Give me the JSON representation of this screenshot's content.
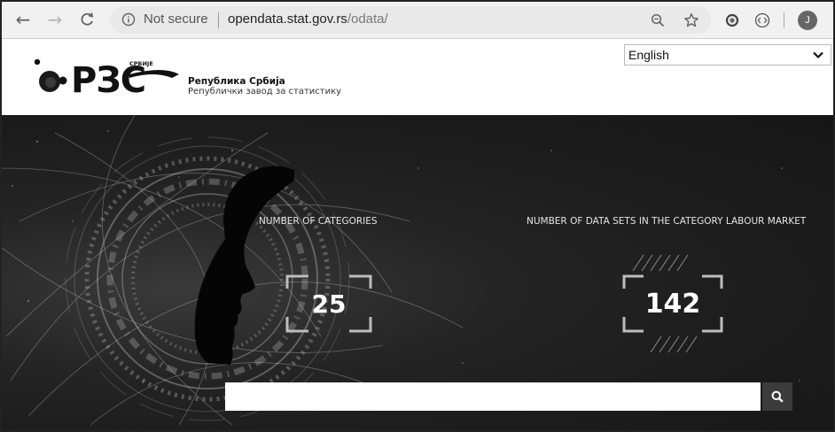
{
  "browser": {
    "security_label": "Not secure",
    "url_host": "opendata.stat.gov.rs",
    "url_path": "/odata/",
    "profile_initial": "J"
  },
  "header": {
    "logo_text": "РЗС",
    "logo_small": "СРБИЈЕ",
    "org_name": "Република Србија",
    "org_subtitle": "Републички завод за статистику",
    "language_selected": "English"
  },
  "stats": [
    {
      "label": "NUMBER OF CATEGORIES",
      "value": "25"
    },
    {
      "label": "NUMBER OF DATA SETS IN THE CATEGORY LABOUR MARKET",
      "value": "142"
    }
  ],
  "search": {
    "placeholder": "",
    "value": ""
  },
  "colors": {
    "hero_bg": "#1c1c1c",
    "search_button": "#3b3b3b"
  }
}
